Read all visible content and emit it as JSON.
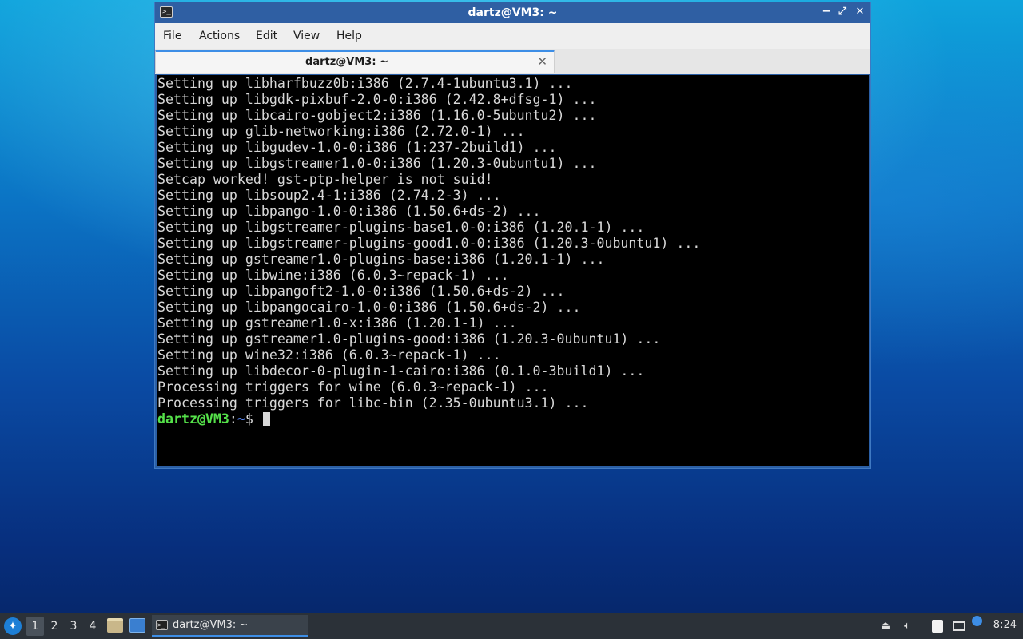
{
  "window": {
    "title": "dartz@VM3: ~",
    "minimize_glyph": "−",
    "maximize_glyph": "⤢",
    "close_glyph": "✕",
    "app_icon": "terminal-icon"
  },
  "menubar": {
    "file": "File",
    "actions": "Actions",
    "edit": "Edit",
    "view": "View",
    "help": "Help"
  },
  "tab": {
    "title": "dartz@VM3: ~",
    "close_glyph": "✕"
  },
  "terminal": {
    "lines": [
      "Setting up libharfbuzz0b:i386 (2.7.4-1ubuntu3.1) ...",
      "Setting up libgdk-pixbuf-2.0-0:i386 (2.42.8+dfsg-1) ...",
      "Setting up libcairo-gobject2:i386 (1.16.0-5ubuntu2) ...",
      "Setting up glib-networking:i386 (2.72.0-1) ...",
      "Setting up libgudev-1.0-0:i386 (1:237-2build1) ...",
      "Setting up libgstreamer1.0-0:i386 (1.20.3-0ubuntu1) ...",
      "Setcap worked! gst-ptp-helper is not suid!",
      "Setting up libsoup2.4-1:i386 (2.74.2-3) ...",
      "Setting up libpango-1.0-0:i386 (1.50.6+ds-2) ...",
      "Setting up libgstreamer-plugins-base1.0-0:i386 (1.20.1-1) ...",
      "Setting up libgstreamer-plugins-good1.0-0:i386 (1.20.3-0ubuntu1) ...",
      "Setting up gstreamer1.0-plugins-base:i386 (1.20.1-1) ...",
      "Setting up libwine:i386 (6.0.3~repack-1) ...",
      "Setting up libpangoft2-1.0-0:i386 (1.50.6+ds-2) ...",
      "Setting up libpangocairo-1.0-0:i386 (1.50.6+ds-2) ...",
      "Setting up gstreamer1.0-x:i386 (1.20.1-1) ...",
      "Setting up gstreamer1.0-plugins-good:i386 (1.20.3-0ubuntu1) ...",
      "Setting up wine32:i386 (6.0.3~repack-1) ...",
      "Setting up libdecor-0-plugin-1-cairo:i386 (0.1.0-3build1) ...",
      "Processing triggers for wine (6.0.3~repack-1) ...",
      "Processing triggers for libc-bin (2.35-0ubuntu3.1) ..."
    ],
    "prompt_user": "dartz@VM3",
    "prompt_sep": ":",
    "prompt_path": "~",
    "prompt_symbol": "$ "
  },
  "taskbar": {
    "start_icon": "lubuntu-menu-icon",
    "desktops": [
      "1",
      "2",
      "3",
      "4"
    ],
    "active_desktop": "1",
    "quick_launch": [
      "file-manager-icon",
      "show-desktop-icon"
    ],
    "task_label": "dartz@VM3: ~",
    "tray_icons": [
      "removable-media-icon",
      "volume-icon",
      "clipboard-icon",
      "network-icon",
      "update-notifier-icon"
    ],
    "clock": "8:24"
  },
  "colors": {
    "titlebar": "#2f5fa3",
    "prompt_user": "#55e24a",
    "prompt_path": "#5c8cff",
    "accent": "#3d8ee6"
  }
}
